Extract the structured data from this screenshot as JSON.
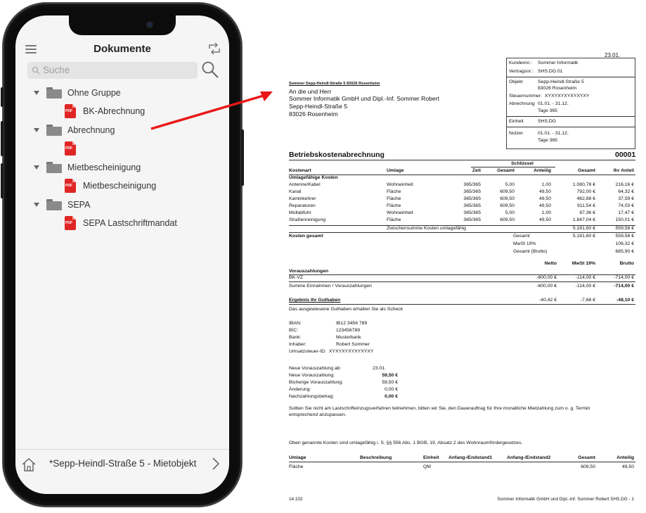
{
  "app": {
    "title": "Dokumente",
    "search_placeholder": "Suche",
    "tree": [
      {
        "group": "Ohne Gruppe",
        "docs": [
          "BK-Abrechnung"
        ]
      },
      {
        "group": "Abrechnung",
        "docs": [
          ""
        ]
      },
      {
        "group": "Mietbescheinigung",
        "docs": [
          "Mietbescheinigung"
        ]
      },
      {
        "group": "SEPA",
        "docs": [
          "SEPA Lastschriftmandat"
        ]
      }
    ],
    "pdf_badge": "PDF",
    "object_label": "*Sepp-Heindl-Straße 5 - Mietobjekt",
    "icons": [
      "menu-icon",
      "sync-icon",
      "search-icon",
      "folder-icon",
      "pdf-icon",
      "home-icon",
      "chevron-right-icon"
    ]
  },
  "arrow_color": "#e81818",
  "document": {
    "date_top": "23.01.",
    "info": [
      {
        "label": "Kundennr.:",
        "value": "Sommer Informatik"
      },
      {
        "label": "Vertragsnr.:",
        "value": "SHS.DG.01"
      },
      {
        "label": "Objekt",
        "value": "Sepp-Heindl-Straße 5"
      },
      {
        "label": "",
        "value": "83026 Rosenheim"
      },
      {
        "label": "Steuernummer:",
        "value": "XYXYXYXYXYXYXY"
      },
      {
        "label": "Abrechnung",
        "value": "01.01.          -   31.12."
      },
      {
        "label": "",
        "value": "Tage    365"
      },
      {
        "label": "Einheit",
        "value": "SHS.DG"
      },
      {
        "label": "Nutzer",
        "value": "01.01.          -   31.12."
      },
      {
        "label": "",
        "value": "Tage    365"
      }
    ],
    "sender_line": "Sommer Sepp-Heindl-Straße 5 83026 Rosenheim",
    "address": [
      "An die und Herr",
      "Sommer Informatik GmbH und Dipl.-Inf. Sommer Robert",
      "Sepp-Heindl-Straße 5",
      "83026 Rosenheim"
    ],
    "title": "Betriebskostenabrechnung",
    "number": "00001",
    "header_schluessel": "Schlüssel",
    "headers": [
      "Kostenart",
      "Umlage",
      "Zeit",
      "Gesamt",
      "Anteilig",
      "Gesamt",
      "Ihr Anteil"
    ],
    "section_umlage": "Umlagefähige Kosten",
    "rows": [
      [
        "Antenne/Kabel",
        "Wohneinheit",
        "365/365",
        "5,00",
        "1,00",
        "1.080,78 €",
        "216,16 €"
      ],
      [
        "Kanal",
        "Fläche",
        "365/365",
        "609,50",
        "49,50",
        "792,00 €",
        "64,32 €"
      ],
      [
        "Kaminkehrer",
        "Fläche",
        "365/365",
        "609,50",
        "49,50",
        "462,88 €",
        "37,59 €"
      ],
      [
        "Reparaturen",
        "Fläche",
        "365/365",
        "609,50",
        "49,50",
        "911,54 €",
        "74,03 €"
      ],
      [
        "Müllabfuhr",
        "Wohneinheit",
        "365/365",
        "5,00",
        "1,00",
        "87,36 €",
        "17,47 €"
      ],
      [
        "Straßenreinigung",
        "Fläche",
        "365/365",
        "609,50",
        "49,50",
        "1.847,04 €",
        "150,01 €"
      ]
    ],
    "subtotal": {
      "label": "Zwischensumme Kosten umlagefähig",
      "gesamt": "5.181,60 €",
      "anteil": "559,58 €"
    },
    "kosten_gesamt": {
      "label": "Kosten gesamt",
      "lines": [
        {
          "label": "Gesamt",
          "gesamt": "5.181,60 €",
          "anteil": "559,58 €"
        },
        {
          "label": "MwSt 19%",
          "gesamt": "",
          "anteil": "106,32 €"
        },
        {
          "label": "Gesamt (Brutto)",
          "gesamt": "",
          "anteil": "665,90 €"
        }
      ]
    },
    "vz_headers": [
      "Netto",
      "MwSt 19%",
      "Brutto"
    ],
    "vz_title": "Vorauszahlungen",
    "vz_row": {
      "label": "BK-VZ",
      "netto": "-600,00 €",
      "mwst": "-114,00 €",
      "brutto": "-714,00 €"
    },
    "vz_sum": {
      "label": "Summe Einnahmen / Vorauszahlungen",
      "netto": "-600,00 €",
      "mwst": "-114,00 €",
      "brutto": "-714,00 €"
    },
    "result": {
      "label": "Ergebnis Ihr Guthaben",
      "netto": "-40,42 €",
      "mwst": "-7,68 €",
      "brutto": "-48,10 €"
    },
    "guthaben_note": "Das ausgewiesene Guthaben erhalten Sie als Scheck",
    "bank": [
      {
        "label": "IBAN:",
        "value": "IB12 3456 789"
      },
      {
        "label": "BIC:",
        "value": "123456789"
      },
      {
        "label": "Bank:",
        "value": "Musterbank"
      },
      {
        "label": "Inhaber:",
        "value": "Robert Sommer"
      },
      {
        "label": "Umsatzsteuer-ID:",
        "value": "XYXYXYXYXYXYXY"
      }
    ],
    "new_vz": [
      {
        "label": "Neue Vorauszahlung ab:",
        "value": "23.01."
      },
      {
        "label": "Neue Vorauszahlung:",
        "value": "59,50 €"
      },
      {
        "label": "Bisherige Vorauszahlung:",
        "value": "59,50 €"
      },
      {
        "label": "Änderung:",
        "value": "0,00 €"
      },
      {
        "label": "Nachzahlungsbetrag:",
        "value": "0,00 €"
      }
    ],
    "lastschrift_note": [
      "Sollten Sie nicht am Lastschrifteinzugsverfahren teilnehmen, bitten wir Sie, den Dauerauftrag für Ihre monatliche Mietzahlung zum o. g. Termin",
      "entsprechend anzupassen."
    ],
    "legal_note": "Oben genannte Kosten sind umlagefähig i. S. §§ 556 Abs. 1 BGB, 19, Absatz 2 des Wohnraumfördergesetzes.",
    "unit_headers": [
      "Umlage",
      "Beschreibung",
      "Einheit",
      "Anfang-/Endstand1",
      "Anfang-/Endstand2",
      "Gesamt",
      "Anteilig"
    ],
    "unit_row": [
      "Fläche",
      "",
      "QM",
      "",
      "",
      "609,50",
      "49,50"
    ],
    "footer_left": "14.102",
    "footer_right": "Sommer Informatik GmbH und Dipl.-Inf. Sommer Robert SHS.DG - 1"
  }
}
